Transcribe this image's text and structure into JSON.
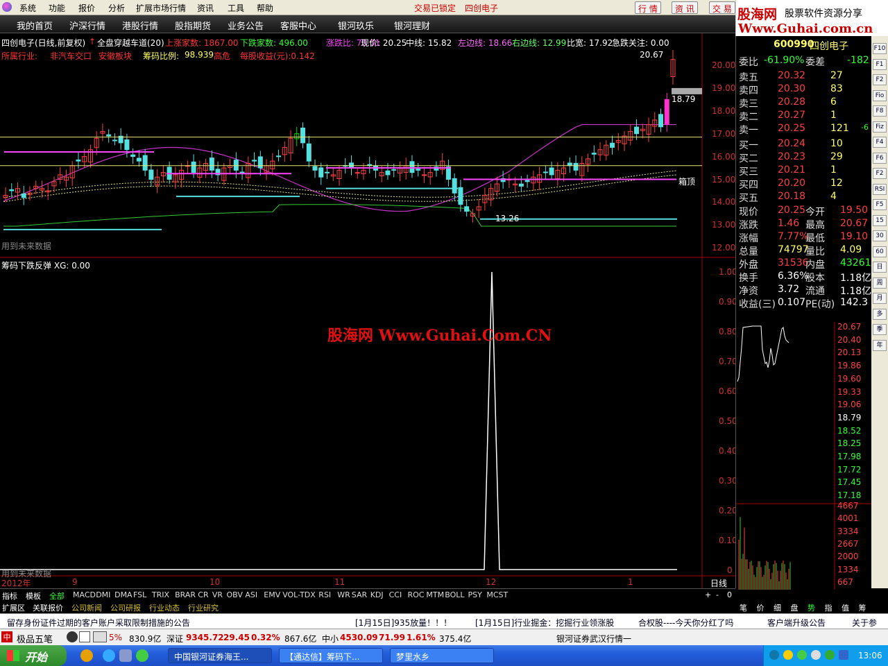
{
  "menubar": {
    "items": [
      "系统",
      "功能",
      "报价",
      "分析",
      "扩展市场行情",
      "资讯",
      "工具",
      "帮助"
    ],
    "status": "交易已锁定",
    "stock": "四创电子",
    "buttons": [
      "行 情",
      "资 讯",
      "交 易"
    ]
  },
  "nav": [
    "我的首页",
    "沪深行情",
    "港股行情",
    "股指期货",
    "业务公告",
    "客服中心",
    "银河玖乐",
    "银河理财"
  ],
  "brand": {
    "name": "股海网",
    "slogan": "股票软件资源分享",
    "url": "Www.Guhai.com.cn"
  },
  "header": {
    "line1": [
      {
        "t": "四创电子(日线,前复权)",
        "c": "#ffffff"
      },
      {
        "t": "↑",
        "c": "#ff3333"
      },
      {
        "t": "全盘穿越车道(20)",
        "c": "#ffffff"
      },
      {
        "t": "上涨家数: 1867.00",
        "c": "#ff3333"
      },
      {
        "t": "下跌家数: 496.00",
        "c": "#33ff33"
      },
      {
        "t": "涨跌比: 79.01",
        "c": "#ff44ff"
      },
      {
        "t": "现价: 20.25",
        "c": "#ffffff"
      },
      {
        "t": "中线: 15.82",
        "c": "#ffffff"
      },
      {
        "t": "左边线: 18.66",
        "c": "#ff66ff"
      },
      {
        "t": "右边线: 12.99",
        "c": "#66ff66"
      },
      {
        "t": "比宽: 17.92",
        "c": "#ffffff"
      },
      {
        "t": "急跌关注: 0.00",
        "c": "#ffffff"
      }
    ],
    "line2": [
      {
        "t": "所属行业:",
        "c": "#ff3333"
      },
      {
        "t": "非汽车交口",
        "c": "#ff3333"
      },
      {
        "t": "安徽板块",
        "c": "#ff3333"
      },
      {
        "t": "筹码比例:",
        "c": "#ffff66"
      },
      {
        "t": "98.939",
        "c": "#ffff66"
      },
      {
        "t": "高危",
        "c": "#ff3333"
      },
      {
        "t": "每股收益(元):0.142",
        "c": "#ff3333"
      }
    ],
    "price_tags": {
      "high": "20.67",
      "mid": "18.79",
      "low": "13.26",
      "box": "箱顶"
    },
    "future_note": "用到未来数据",
    "sub_title": "筹码下跌反弹",
    "sub_value": "XG: 0.00"
  },
  "watermark": "股海网 Www.Guhai.Com.CN",
  "main_axis": [
    "20.00",
    "19.00",
    "18.00",
    "17.00",
    "16.00",
    "15.00",
    "14.00",
    "13.00",
    "12.00"
  ],
  "sub_axis": [
    "1.00",
    "0.90",
    "0.80",
    "0.70",
    "0.60",
    "0.50",
    "0.40",
    "0.30",
    "0.20",
    "0.10",
    "0"
  ],
  "time_axis": [
    "2012年",
    "9",
    "10",
    "11",
    "12",
    "1"
  ],
  "period": "日线",
  "quote": {
    "code": "600990",
    "name": "四创电子",
    "webi_label": "委比",
    "webi": "-61.90%",
    "wecha_label": "委差",
    "wecha": "-182",
    "asks": [
      {
        "l": "卖五",
        "p": "20.32",
        "v": "27"
      },
      {
        "l": "卖四",
        "p": "20.30",
        "v": "83"
      },
      {
        "l": "卖三",
        "p": "20.28",
        "v": "6"
      },
      {
        "l": "卖二",
        "p": "20.27",
        "v": "1"
      },
      {
        "l": "卖一",
        "p": "20.25",
        "v": "121",
        "x": "-6"
      }
    ],
    "bids": [
      {
        "l": "买一",
        "p": "20.24",
        "v": "10"
      },
      {
        "l": "买二",
        "p": "20.23",
        "v": "29"
      },
      {
        "l": "买三",
        "p": "20.21",
        "v": "1"
      },
      {
        "l": "买四",
        "p": "20.20",
        "v": "12"
      },
      {
        "l": "买五",
        "p": "20.18",
        "v": "4"
      }
    ],
    "stats": [
      {
        "a": "现价",
        "av": "20.25",
        "b": "今开",
        "bv": "19.50"
      },
      {
        "a": "涨跌",
        "av": "1.46",
        "b": "最高",
        "bv": "20.67"
      },
      {
        "a": "涨幅",
        "av": "7.77%",
        "b": "最低",
        "bv": "19.10"
      },
      {
        "a": "总量",
        "av": "74797",
        "b": "量比",
        "bv": "4.09"
      },
      {
        "a": "外盘",
        "av": "31536",
        "b": "内盘",
        "bv": "43261"
      },
      {
        "a": "换手",
        "av": "6.36%",
        "b": "股本",
        "bv": "1.18亿"
      },
      {
        "a": "净资",
        "av": "3.72",
        "b": "流通",
        "bv": "1.18亿"
      },
      {
        "a": "收益(三)",
        "av": "0.107",
        "b": "PE(动)",
        "bv": "142.3"
      }
    ],
    "intraday_axis": [
      "20.67",
      "20.40",
      "20.13",
      "19.86",
      "19.60",
      "19.33",
      "19.06",
      "18.79",
      "18.52",
      "18.25",
      "17.98",
      "17.72",
      "17.45",
      "17.18"
    ],
    "vol_axis": [
      "4667",
      "4001",
      "3334",
      "2667",
      "2000",
      "1334",
      "667"
    ],
    "tabs": [
      "笔",
      "价",
      "细",
      "盘",
      "势",
      "指",
      "值",
      "筹"
    ]
  },
  "sidebar": [
    "F10",
    "F1",
    "F2",
    "Fio",
    "F8",
    "Fiz",
    "F4",
    "F6",
    "F2",
    "RSI",
    "F5",
    "15",
    "30",
    "60",
    "日",
    "周",
    "月",
    "多",
    "季",
    "年"
  ],
  "indicators": [
    "指标",
    "模板",
    "全部",
    "MACD",
    "DMI",
    "DMA",
    "FSL",
    "TRIX",
    "BRAR",
    "CR",
    "VR",
    "OBV",
    "ASI",
    "EMV",
    "VOL-TDX",
    "RSI",
    "WR",
    "SAR",
    "KDJ",
    "CCI",
    "ROC",
    "MTM",
    "BOLL",
    "PSY",
    "MCST"
  ],
  "subtabs": [
    "扩展区",
    "关联报价",
    "公司新闻",
    "公司研报",
    "行业动态",
    "行业研究"
  ],
  "news": [
    "留存身份证件过期的客户账户采取限制措施的公告",
    "[1月15日]935放量！！！",
    "[1月15日]行业掘金：挖掘行业领涨股",
    "合权股----今天你分红了吗",
    "客户端升级公告",
    "关于参"
  ],
  "ticker": {
    "app": "极品五笔",
    "items": [
      "5%",
      "830.9亿",
      "深证",
      "9345.72",
      "29.45",
      "0.32%",
      "867.6亿",
      "中小",
      "4530.09",
      "71.99",
      "1.61%",
      "375.4亿"
    ],
    "status": "银河证券武汉行情一"
  },
  "taskbar": {
    "start": "开始",
    "tasks": [
      "中国银河证券海王...",
      "【通达信】筹码下...",
      "梦里水乡"
    ],
    "time": "13:06"
  },
  "chart_data": {
    "type": "candlestick",
    "x_ticks": [
      "9",
      "10",
      "11",
      "12",
      "1"
    ],
    "ylim": [
      12,
      20.5
    ],
    "highlight": {
      "price": 20.25,
      "high": 20.67,
      "low": 13.26
    },
    "sub_series": {
      "name": "XG",
      "peak": 1.0,
      "ylim": [
        0,
        1
      ]
    }
  }
}
